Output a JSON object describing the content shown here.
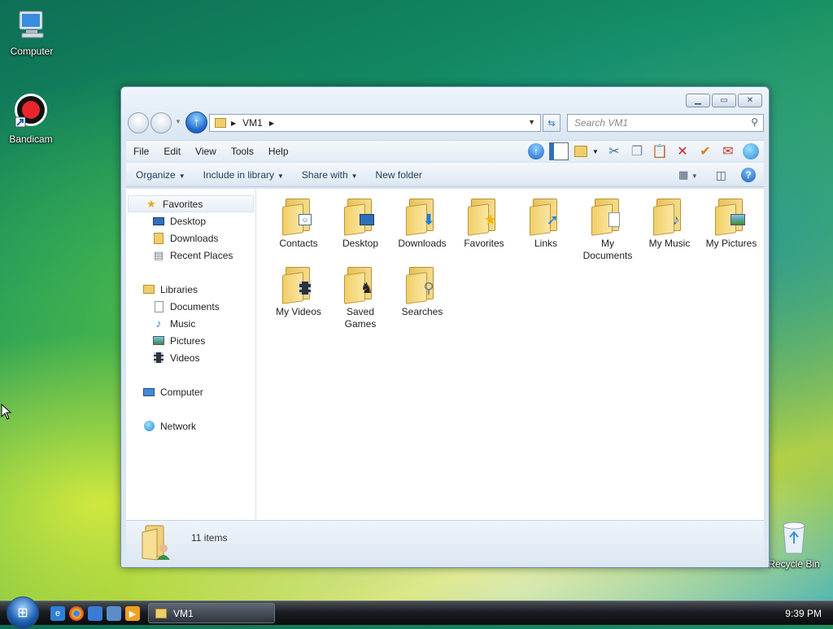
{
  "desktop": {
    "icons": [
      {
        "label": "Computer"
      },
      {
        "label": "Bandicam"
      },
      {
        "label": "Recycle Bin"
      }
    ]
  },
  "window": {
    "address": {
      "root_icon": "folder-user-icon",
      "path": "VM1"
    },
    "search": {
      "placeholder": "Search VM1"
    },
    "menu": [
      "File",
      "Edit",
      "View",
      "Tools",
      "Help"
    ],
    "commands": {
      "organize": "Organize",
      "include_in_library": "Include in library",
      "share_with": "Share with",
      "new_folder": "New folder"
    },
    "nav": {
      "favorites": {
        "label": "Favorites",
        "items": [
          "Desktop",
          "Downloads",
          "Recent Places"
        ]
      },
      "libraries": {
        "label": "Libraries",
        "items": [
          "Documents",
          "Music",
          "Pictures",
          "Videos"
        ]
      },
      "computer": "Computer",
      "network": "Network"
    },
    "items": [
      {
        "label": "Contacts",
        "badge": "contact-card-icon"
      },
      {
        "label": "Desktop",
        "badge": "desktop-icon"
      },
      {
        "label": "Downloads",
        "badge": "download-arrow-icon"
      },
      {
        "label": "Favorites",
        "badge": "star-icon"
      },
      {
        "label": "Links",
        "badge": "link-arrow-icon"
      },
      {
        "label": "My Documents",
        "badge": "document-icon"
      },
      {
        "label": "My Music",
        "badge": "music-note-icon"
      },
      {
        "label": "My Pictures",
        "badge": "picture-icon"
      },
      {
        "label": "My Videos",
        "badge": "film-icon"
      },
      {
        "label": "Saved Games",
        "badge": "chess-piece-icon"
      },
      {
        "label": "Searches",
        "badge": "magnifier-icon"
      }
    ],
    "details": {
      "count": "11 items"
    }
  },
  "taskbar": {
    "task": "VM1",
    "clock": "9:39 PM"
  }
}
